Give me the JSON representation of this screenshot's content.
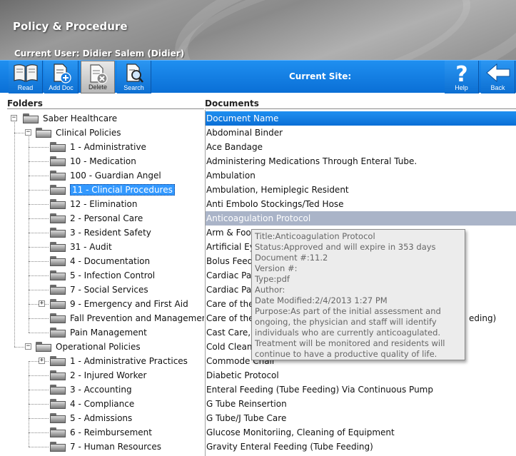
{
  "header": {
    "title": "Policy & Procedure",
    "current_user": "Current User: Didier Salem (Didier)"
  },
  "toolbar": {
    "read_label": "Read",
    "add_doc_label": "Add Doc",
    "delete_label": "Delete",
    "search_label": "Search",
    "site_label": "Current Site:",
    "help_label": "Help",
    "back_label": "Back"
  },
  "columns": {
    "folders": "Folders",
    "documents": "Documents"
  },
  "folders": {
    "root": "Saber Healthcare",
    "clinical": "Clinical Policies",
    "clinical_items": [
      "1 - Administrative",
      "10 - Medication",
      "100 - Guardian Angel",
      "11 - Clincial Procedures",
      "12 - Elimination",
      "2 - Personal Care",
      "3 - Resident Safety",
      "31 - Audit",
      "4 - Documentation",
      "5 - Infection Control",
      "7 - Social Services",
      "9 - Emergency and First Aid",
      "Fall Prevention and Management",
      "Pain Management"
    ],
    "operational": "Operational Policies",
    "operational_items": [
      "1 - Administrative Practices",
      "2 - Injured Worker",
      "3 - Accounting",
      "4 - Compliance",
      "5 - Admissions",
      "6 - Reimbursement",
      "7 - Human Resources"
    ]
  },
  "documents": {
    "header": "Document Name",
    "items": [
      "Abdominal Binder",
      "Ace Bandage",
      "Administering Medications Through Enteral Tube.",
      "Ambulation",
      "Ambulation, Hemiplegic Resident",
      "Anti Embolo Stockings/Ted Hose",
      "Anticoagulation Protocol",
      "Arm & Foot",
      "Artificial Ey",
      "Bolus Feed",
      "Cardiac Pa",
      "Cardiac Pa",
      "Care of the",
      "Care of the",
      "Cast Care,",
      "Cold Clean",
      "Commode Chair",
      "Diabetic Protocol",
      "Enteral Feeding (Tube Feeding) Via Continuous Pump",
      "G Tube Reinsertion",
      "G Tube/J Tube Care",
      "Glucose Monitoriing, Cleaning of Equipment",
      "Gravity Enteral Feeding (Tube Feeding)"
    ],
    "row13_tail": "eding)"
  },
  "tooltip": {
    "title": "Title:Anticoagulation Protocol",
    "status": "Status:Approved and will expire in 353 days",
    "doc_no": "Document #:11.2",
    "version": "Version #:",
    "type": "Type:pdf",
    "author": "Author:",
    "modified": "Date Modified:2/4/2013 1:27 PM",
    "purpose": "Purpose:As part of the initial assessment and ongoing, the physician and staff will identify individuals who are currently anticoagulated. Treatment will be monitored and residents will continue to have a productive quality of life."
  }
}
